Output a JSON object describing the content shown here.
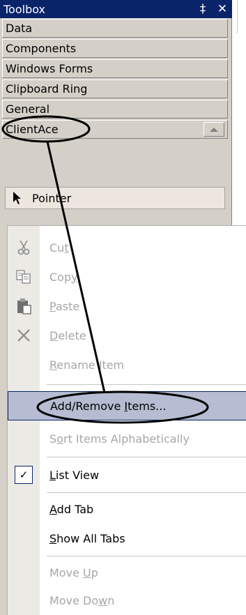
{
  "toolbox": {
    "title": "Toolbox",
    "pin_glyph": "‡",
    "close_glyph": "✕",
    "tabs": [
      {
        "label": "Data"
      },
      {
        "label": "Components"
      },
      {
        "label": "Windows Forms"
      },
      {
        "label": "Clipboard Ring"
      },
      {
        "label": "General"
      },
      {
        "label": "ClientAce"
      }
    ],
    "items": [
      {
        "label": "Pointer",
        "icon": "pointer-arrow-icon"
      }
    ]
  },
  "context_menu": {
    "items": [
      {
        "label": "Cut",
        "mnemonic": "t",
        "enabled": false,
        "icon": "scissors-icon"
      },
      {
        "label": "Copy",
        "mnemonic": "y",
        "enabled": false,
        "icon": "copy-icon"
      },
      {
        "label": "Paste",
        "mnemonic": "P",
        "enabled": false,
        "icon": "paste-icon"
      },
      {
        "label": "Delete",
        "mnemonic": "D",
        "enabled": false,
        "icon": "delete-icon"
      },
      {
        "label": "Rename Item",
        "mnemonic": "R",
        "enabled": false
      },
      {
        "label": "Add/Remove Items...",
        "mnemonic": "I",
        "enabled": true,
        "highlighted": true
      },
      {
        "label": "Sort Items Alphabetically",
        "mnemonic": "o",
        "enabled": false
      },
      {
        "label": "List View",
        "mnemonic": "L",
        "enabled": true,
        "checked": true
      },
      {
        "label": "Add Tab",
        "mnemonic": "A",
        "enabled": true
      },
      {
        "label": "Show All Tabs",
        "mnemonic": "S",
        "enabled": true
      },
      {
        "label": "Move Up",
        "mnemonic": "U",
        "enabled": false
      },
      {
        "label": "Move Down",
        "mnemonic": "w",
        "enabled": false
      }
    ]
  },
  "colors": {
    "titlebar": "#0a246a",
    "panel": "#d4d0c8",
    "highlight": "#b6bdd2",
    "disabled_text": "#a6a6a6",
    "annotation": "#000000"
  }
}
